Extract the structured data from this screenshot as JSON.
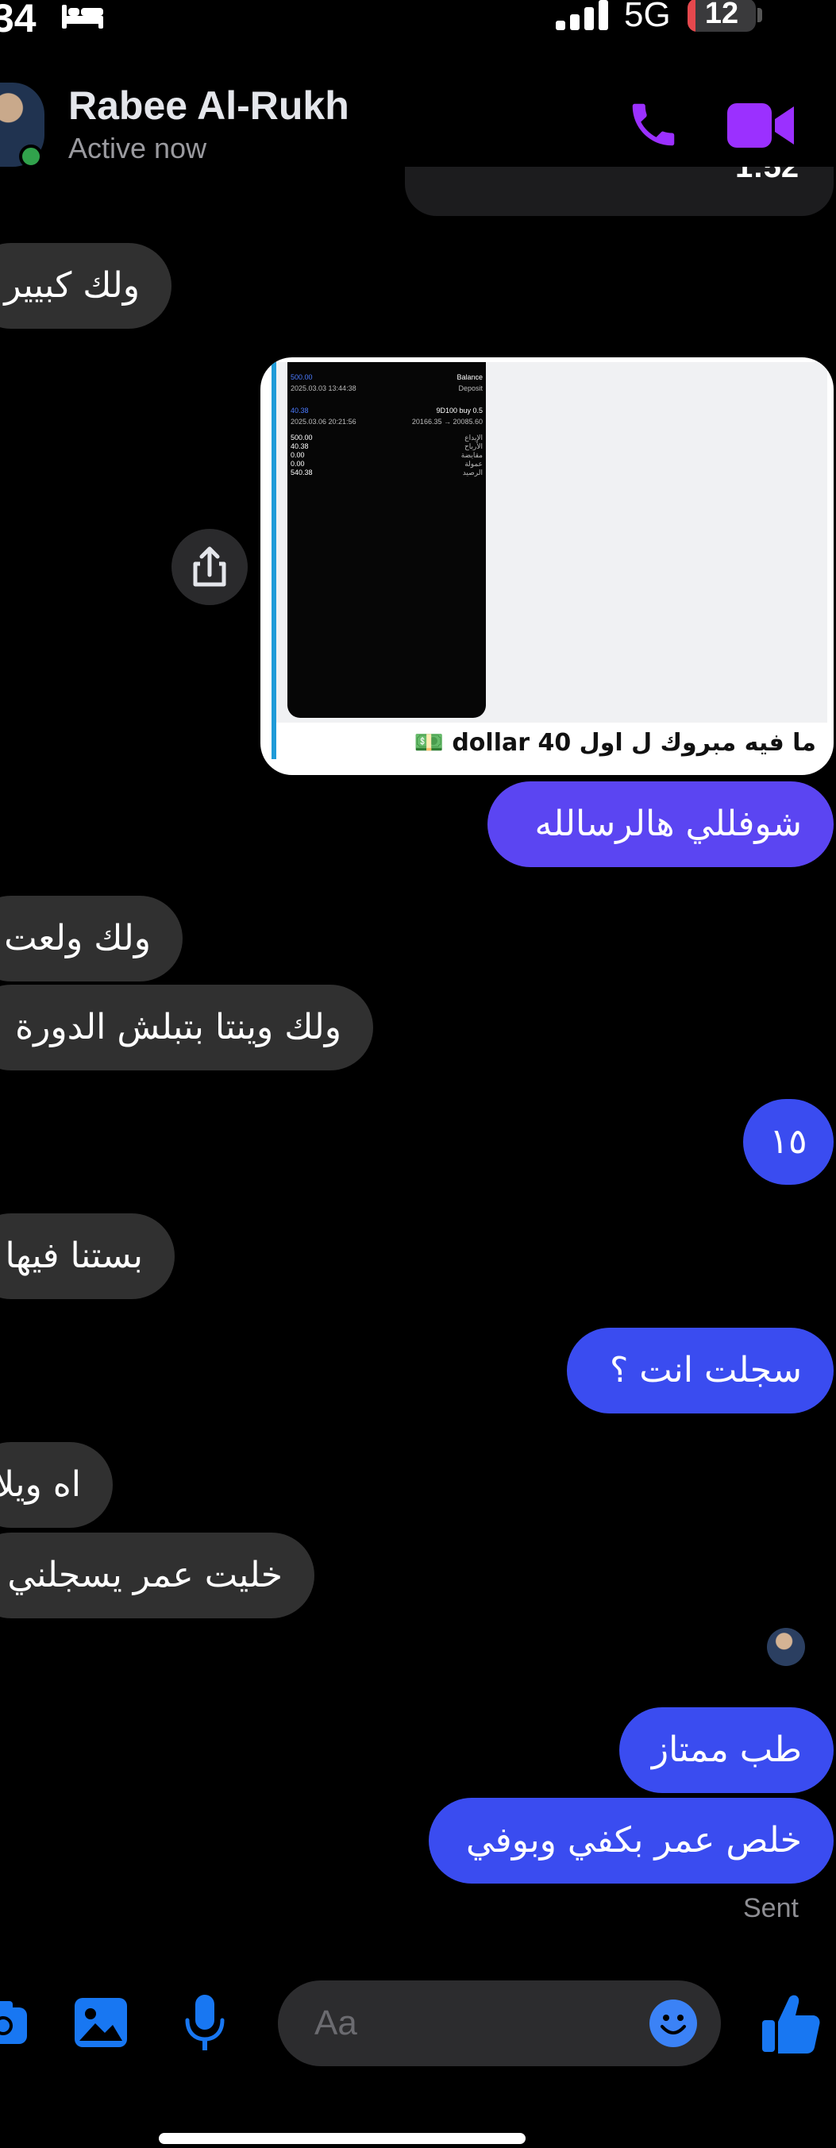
{
  "status_bar": {
    "time": "34",
    "network": "5G",
    "battery": "12",
    "battery_level": 0.12,
    "icons": [
      "bed-icon",
      "signal-icon"
    ]
  },
  "header": {
    "name": "Rabee Al-Rukh",
    "status": "Active now",
    "top_bubble_fragment": "1:52",
    "call_icon": "phone-icon",
    "video_icon": "video-camera-icon",
    "accent": "#9b30ff",
    "online_color": "#31a24c"
  },
  "attachment": {
    "caption": "ما فيه مبروك ل اول 40 dollar 💵",
    "screen": {
      "balance_label": "Balance",
      "deposit_label": "Deposit",
      "amount_1": "500.00",
      "date_1": "2025.03.03 13:44:38",
      "amount_2": "40.38",
      "code": "9D100 buy 0.5",
      "date_2": "2025.03.06 20:21:56",
      "range": "20166.35 → 20085.60",
      "rows": [
        {
          "value": "500.00",
          "label": "الإيداع"
        },
        {
          "value": "40.38",
          "label": "الأرباح"
        },
        {
          "value": "0.00",
          "label": "مقايضة"
        },
        {
          "value": "0.00",
          "label": "عمولة"
        },
        {
          "value": "540.38",
          "label": "الرصيد"
        }
      ]
    },
    "stripe_color": "#1f9bd8"
  },
  "messages": [
    {
      "side": "in",
      "text": "ولك كبيير"
    },
    {
      "side": "out",
      "text": "شوفللي هالرسالله"
    },
    {
      "side": "in",
      "text": "ولك ولعت"
    },
    {
      "side": "in",
      "text": "ولك وينتا بتبلش الدورة"
    },
    {
      "side": "out",
      "text": "١٥"
    },
    {
      "side": "in",
      "text": "بستنا فيها"
    },
    {
      "side": "out",
      "text": "سجلت انت ؟"
    },
    {
      "side": "in",
      "text": "اه ويلا"
    },
    {
      "side": "in",
      "text": "خليت عمر يسجلني"
    },
    {
      "side": "out",
      "text": "طب ممتاز"
    },
    {
      "side": "out",
      "text": "خلص عمر بكفي وبوفي"
    }
  ],
  "sent_label": "Sent",
  "composer": {
    "placeholder": "Aa",
    "icons": [
      "camera-icon",
      "image-icon",
      "microphone-icon",
      "emoji-icon",
      "thumbs-up-icon"
    ],
    "accent": "#1877f2"
  },
  "colors": {
    "incoming_bubble": "#303030",
    "outgoing_bubble": "#3a4cf0",
    "outgoing_violet": "#6a3cf5"
  }
}
